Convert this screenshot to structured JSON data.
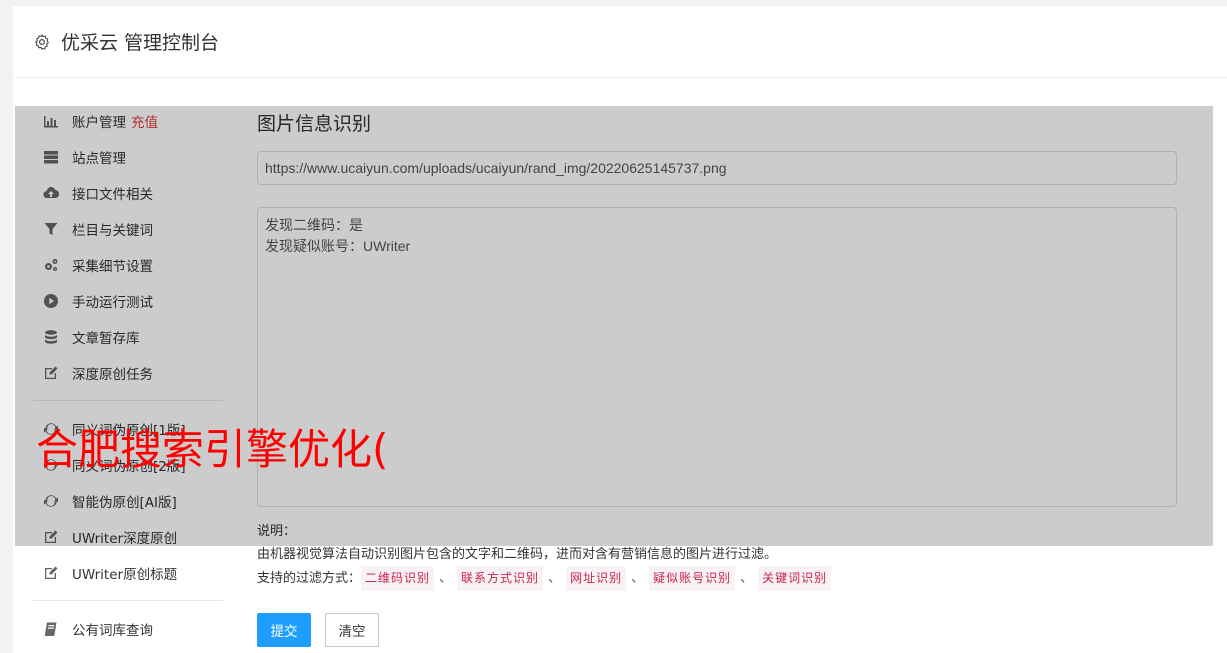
{
  "header": {
    "title": "优采云 管理控制台",
    "icon": "gear-icon"
  },
  "sidebar": {
    "items": [
      {
        "label": "账户管理",
        "extra": "充值",
        "icon": "bar-chart-icon"
      },
      {
        "label": "站点管理",
        "icon": "server-icon"
      },
      {
        "label": "接口文件相关",
        "icon": "cloud-upload-icon"
      },
      {
        "label": "栏目与关键词",
        "icon": "filter-icon"
      },
      {
        "label": "采集细节设置",
        "icon": "cogs-icon"
      },
      {
        "label": "手动运行测试",
        "icon": "play-circle-icon"
      },
      {
        "label": "文章暂存库",
        "icon": "database-icon"
      },
      {
        "label": "深度原创任务",
        "icon": "edit-icon"
      }
    ],
    "items2": [
      {
        "label": "同义词伪原创[1版]",
        "icon": "refresh-icon"
      },
      {
        "label": "同义词伪原创[2版]",
        "icon": "refresh-icon"
      },
      {
        "label": "智能伪原创[AI版]",
        "icon": "refresh-icon"
      },
      {
        "label": "UWriter深度原创",
        "icon": "edit-icon"
      },
      {
        "label": "UWriter原创标题",
        "icon": "edit-icon"
      }
    ],
    "items3": [
      {
        "label": "公有词库查询",
        "icon": "book-icon"
      }
    ]
  },
  "main": {
    "title": "图片信息识别",
    "url_value": "https://www.ucaiyun.com/uploads/ucaiyun/rand_img/20220625145737.png",
    "result_lines": [
      "发现二维码：是",
      "发现疑似账号：UWriter"
    ],
    "notes_label": "说明：",
    "notes_text": "由机器视觉算法自动识别图片包含的文字和二维码，进而对含有营销信息的图片进行过滤。",
    "filter_label": "支持的过滤方式：",
    "filters": [
      "二维码识别",
      "联系方式识别",
      "网址识别",
      "疑似账号识别",
      "关键词识别"
    ],
    "filter_sep": "、",
    "submit_label": "提交",
    "clear_label": "清空"
  },
  "watermark": {
    "text": "合肥搜索引擎优化("
  },
  "colors": {
    "primary": "#1e9fff",
    "recharge": "#e4393c",
    "tag_text": "#c7254e",
    "tag_bg": "#f9f2f4",
    "watermark": "#ff0000"
  }
}
